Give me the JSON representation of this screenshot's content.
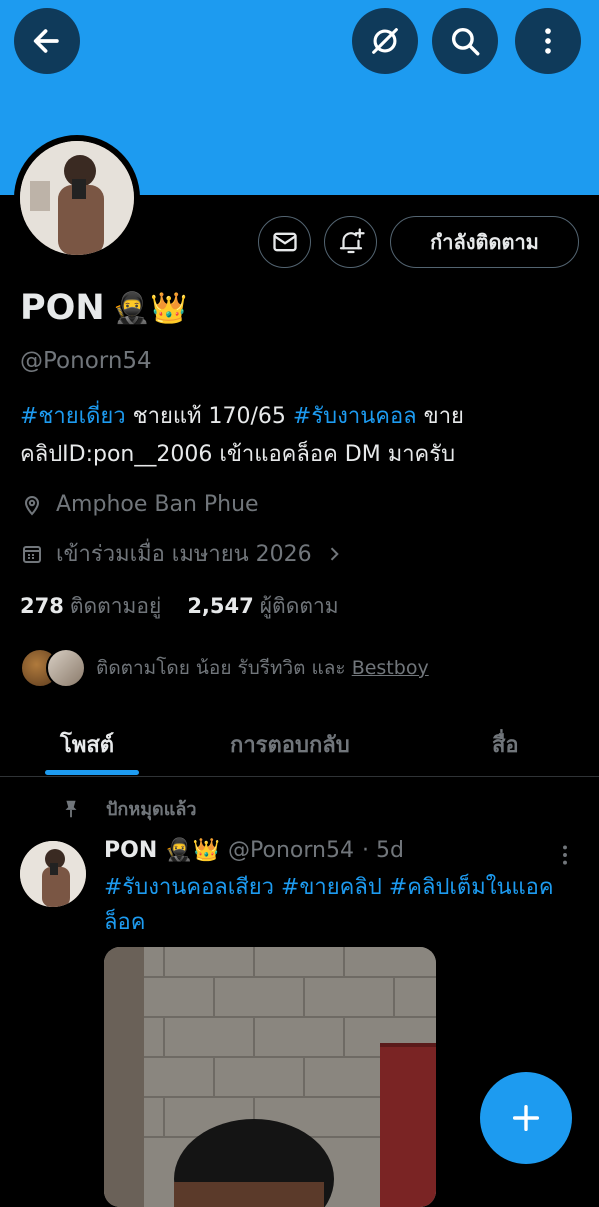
{
  "header": {
    "back_icon": "arrow-left-icon",
    "actions": [
      "no-translate-icon",
      "search-icon",
      "more-vertical-icon"
    ],
    "banner_color": "#1d9bf0"
  },
  "profile": {
    "name": "PON",
    "name_emojis": "🥷👑",
    "handle": "@Ponorn54",
    "follow_button_label": "กำลังติดตาม",
    "bio": {
      "tag1": "#ชายเดี่ยว",
      "text1": " ชายแท้ 170/65 ",
      "tag2": "#รับงานคอล",
      "text2": " ขายคลิปID:pon__2006 เข้าแอคล็อค DM มาครับ"
    },
    "location": "Amphoe Ban Phue",
    "joined": "เข้าร่วมเมื่อ เมษายน 2026",
    "following_count": "278",
    "following_label": "ติดตามอยู่",
    "followers_count": "2,547",
    "followers_label": "ผู้ติดตาม",
    "followed_by_prefix": "ติดตามโดย น้อย รับรีทวิต และ ",
    "followed_by_link": "Bestboy"
  },
  "tabs": [
    {
      "label": "โพสต์",
      "active": true
    },
    {
      "label": "การตอบกลับ",
      "active": false
    },
    {
      "label": "สื่อ",
      "active": false
    }
  ],
  "pinned_post": {
    "pinned_label": "ปักหมุดแล้ว",
    "author_name": "PON",
    "author_emojis": "🥷👑",
    "author_handle": "@Ponorn54",
    "time": "· 5d",
    "text": "#รับงานคอลเสียว #ขายคลิป #คลิปเต็มในแอคล็อค"
  },
  "colors": {
    "accent": "#1d9bf0",
    "background": "#000000",
    "secondary_text": "#71767b"
  }
}
